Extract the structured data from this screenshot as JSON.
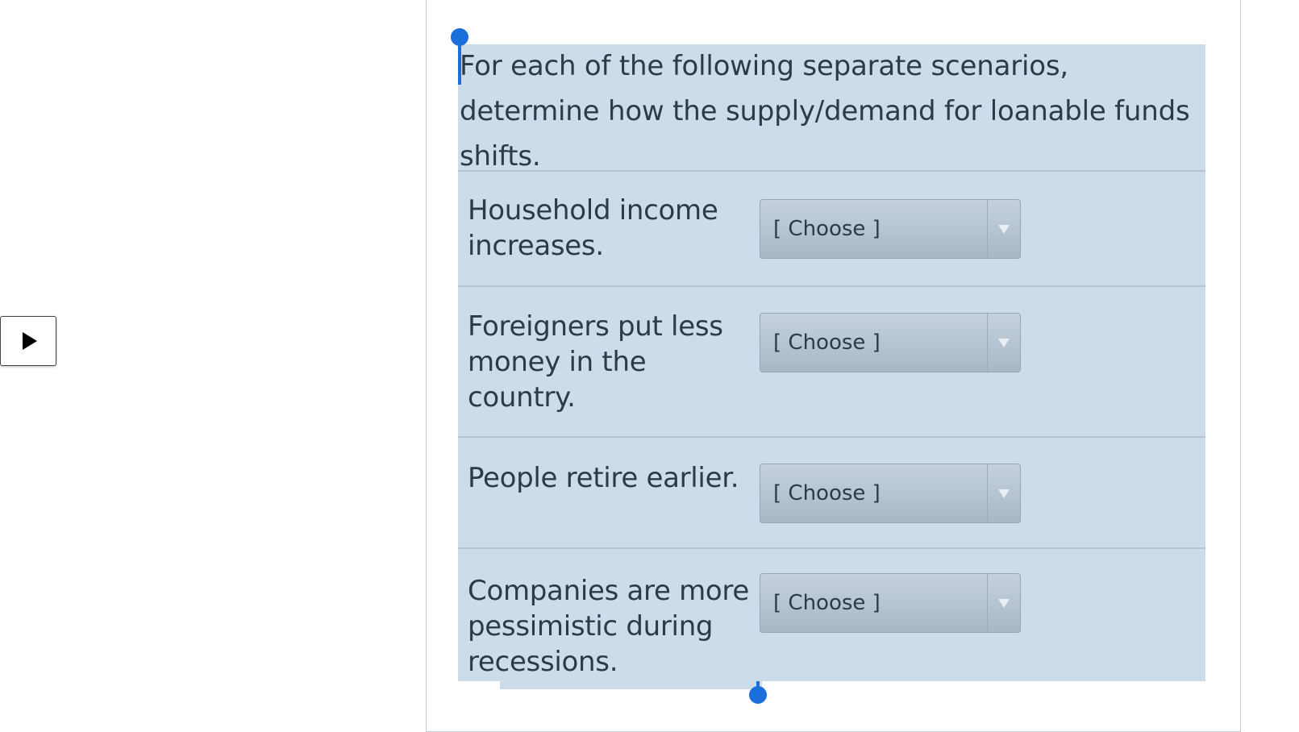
{
  "question": {
    "intro": "For each of the following separate scenarios, determine how the supply/demand for loanable funds shifts."
  },
  "rows": [
    {
      "label": "Household income increases.",
      "select_value": "[ Choose ]"
    },
    {
      "label": "Foreigners put less money in the country.",
      "select_value": "[ Choose ]"
    },
    {
      "label": "People retire earlier.",
      "select_value": "[ Choose ]"
    },
    {
      "label": "Companies are more pessimistic during recessions.",
      "select_value": "[ Choose ]"
    }
  ],
  "icons": {
    "play": "play-icon",
    "dropdown": "chevron-down-icon"
  },
  "colors": {
    "selection_highlight": "#cddcea",
    "handle": "#1a6fdb",
    "text": "#2d3b45"
  }
}
